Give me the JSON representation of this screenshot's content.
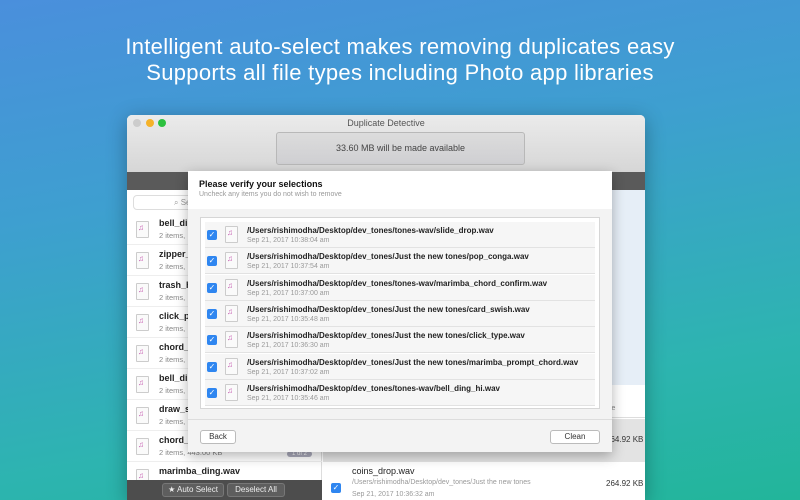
{
  "headline": {
    "line1": "Intelligent auto-select makes removing duplicates easy",
    "line2": "Supports all file types including Photo app libraries"
  },
  "window": {
    "title": "Duplicate Detective",
    "status": "33.60 MB will be made available"
  },
  "sidebar": {
    "search_placeholder": "Se",
    "items": [
      {
        "name": "bell_dir",
        "sub": "2 items,"
      },
      {
        "name": "zipper_",
        "sub": "2 items,"
      },
      {
        "name": "trash_h",
        "sub": "2 items,"
      },
      {
        "name": "click_p",
        "sub": "2 items,"
      },
      {
        "name": "chord_",
        "sub": "2 items,"
      },
      {
        "name": "bell_dir",
        "sub": "2 items,"
      },
      {
        "name": "draw_s",
        "sub": "2 items,"
      },
      {
        "name": "chord_",
        "sub": "2 items, 443.00 KB",
        "badge": "1 of 2"
      },
      {
        "name": "marimba_ding.wav",
        "sub": ""
      }
    ],
    "auto_select": "★ Auto Select",
    "deselect_all": "Deselect All"
  },
  "right": {
    "size_header": "ze",
    "rows": [
      {
        "name": "",
        "path": "",
        "date": "",
        "size": "264.92 KB"
      },
      {
        "name": "coins_drop.wav",
        "path": "/Users/rishimodha/Desktop/dev_tones/Just the new tones",
        "date": "Sep 21, 2017 10:36:32 am",
        "size": "264.92 KB"
      }
    ]
  },
  "sheet": {
    "title": "Please verify your selections",
    "subtitle": "Uncheck any items you do not wish to remove",
    "items": [
      {
        "path": "/Users/rishimodha/Desktop/dev_tones/tones-wav/slide_drop.wav",
        "date": "Sep 21, 2017 10:38:04 am",
        "checked": true
      },
      {
        "path": "/Users/rishimodha/Desktop/dev_tones/Just the new tones/pop_conga.wav",
        "date": "Sep 21, 2017 10:37:54 am",
        "checked": true
      },
      {
        "path": "/Users/rishimodha/Desktop/dev_tones/tones-wav/marimba_chord_confirm.wav",
        "date": "Sep 21, 2017 10:37:00 am",
        "checked": true
      },
      {
        "path": "/Users/rishimodha/Desktop/dev_tones/Just the new tones/card_swish.wav",
        "date": "Sep 21, 2017 10:35:48 am",
        "checked": true
      },
      {
        "path": "/Users/rishimodha/Desktop/dev_tones/Just the new tones/click_type.wav",
        "date": "Sep 21, 2017 10:36:30 am",
        "checked": true
      },
      {
        "path": "/Users/rishimodha/Desktop/dev_tones/Just the new tones/marimba_prompt_chord.wav",
        "date": "Sep 21, 2017 10:37:02 am",
        "checked": true
      },
      {
        "path": "/Users/rishimodha/Desktop/dev_tones/tones-wav/bell_ding_hi.wav",
        "date": "Sep 21, 2017 10:35:46 am",
        "checked": true
      }
    ],
    "back": "Back",
    "clean": "Clean"
  },
  "colors": {
    "accent": "#2f86f0"
  }
}
